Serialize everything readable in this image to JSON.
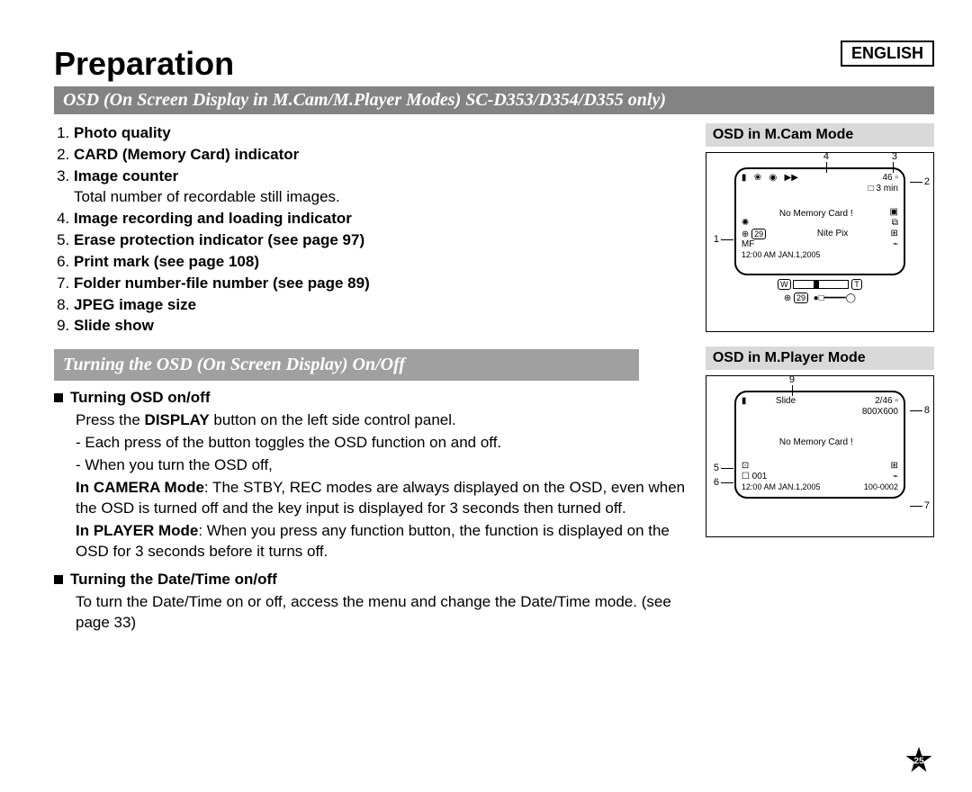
{
  "lang": "ENGLISH",
  "title": "Preparation",
  "bar1": "OSD (On Screen Display in M.Cam/M.Player Modes) SC-D353/D354/D355 only)",
  "items": [
    {
      "label": "Photo quality"
    },
    {
      "label": "CARD (Memory Card) indicator"
    },
    {
      "label": "Image counter",
      "note": "Total number of recordable still images."
    },
    {
      "label": "Image recording and loading indicator"
    },
    {
      "label": "Erase protection indicator (see page 97)"
    },
    {
      "label": "Print mark (see page 108)"
    },
    {
      "label": "Folder number-file number (see page 89)"
    },
    {
      "label": "JPEG image size"
    },
    {
      "label": "Slide show"
    }
  ],
  "bar2": "Turning the OSD (On Screen Display) On/Off",
  "sect1": {
    "hdr": "Turning OSD on/off",
    "line1a": "Press the ",
    "display": "DISPLAY",
    "line1b": " button on the left side control panel.",
    "d1": "- Each press of the button toggles the OSD function on and off.",
    "d2": "- When you turn the OSD off,",
    "cam_b": "In CAMERA Mode",
    "cam_t": ": The STBY, REC modes are always displayed on the OSD, even when the OSD is turned off and the key input is displayed for 3 seconds then turned off.",
    "ply_b": "In PLAYER Mode",
    "ply_t": ": When you press any function button, the function is displayed on the OSD for 3 seconds before it turns off."
  },
  "sect2": {
    "hdr": "Turning the Date/Time on/off",
    "t": "To turn the Date/Time on or off, access the menu and change the Date/Time mode. (see page 33)"
  },
  "panelA": {
    "title": "OSD in M.Cam Mode",
    "count": "46",
    "time": "3 min",
    "msg": "No Memory Card !",
    "nite": "Nite Pix",
    "date": "12:00 AM JAN.1,2005",
    "c1": "1",
    "c2": "2",
    "c3": "3",
    "c4": "4",
    "zW": "W",
    "zT": "T",
    "n29": "29"
  },
  "panelB": {
    "title": "OSD in M.Player Mode",
    "slide": "Slide",
    "count": "2/46",
    "size": "800X600",
    "msg": "No Memory Card !",
    "dir": "001",
    "date": "12:00 AM JAN.1,2005",
    "file": "100-0002",
    "c5": "5",
    "c6": "6",
    "c7": "7",
    "c8": "8",
    "c9": "9"
  },
  "pageno": "25"
}
